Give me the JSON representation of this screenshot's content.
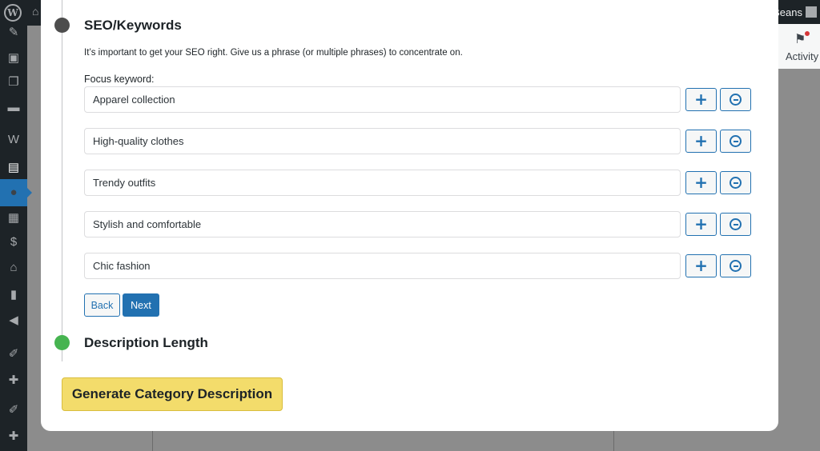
{
  "adminbar": {
    "wp_logo_glyph": "W",
    "home_glyph": "⌂",
    "user_name": "Beans"
  },
  "sidebar": {
    "items": [
      {
        "icon": "pin-icon",
        "glyph": "✎"
      },
      {
        "icon": "media-icon",
        "glyph": "▣"
      },
      {
        "icon": "pages-icon",
        "glyph": "❐"
      },
      {
        "icon": "comments-icon",
        "glyph": "▬"
      },
      {
        "icon": "woocommerce-icon",
        "glyph": "W"
      },
      {
        "icon": "products-icon",
        "glyph": "▤"
      },
      {
        "icon": "circle-icon",
        "glyph": "●"
      },
      {
        "icon": "layout-icon",
        "glyph": "▦"
      },
      {
        "icon": "payments-icon",
        "glyph": "$"
      },
      {
        "icon": "store-icon",
        "glyph": "⌂"
      },
      {
        "icon": "analytics-icon",
        "glyph": "▮"
      },
      {
        "icon": "marketing-icon",
        "glyph": "◀"
      },
      {
        "icon": "appearance-icon",
        "glyph": "✐"
      },
      {
        "icon": "plugins-icon",
        "glyph": "✚"
      },
      {
        "icon": "tools-icon",
        "glyph": "✐"
      },
      {
        "icon": "settings-icon",
        "glyph": "✚"
      }
    ]
  },
  "header": {
    "activity_label": "Activity",
    "flag_glyph": "⚑"
  },
  "seo": {
    "title": "SEO/Keywords",
    "intro": "It’s important to get your SEO right. Give us a phrase (or multiple phrases) to concentrate on.",
    "focus_label": "Focus keyword:",
    "plus_glyph": "+",
    "keywords": [
      "Apparel collection",
      "High-quality clothes",
      "Trendy outfits",
      "Stylish and comfortable",
      "Chic fashion"
    ],
    "back_label": "Back",
    "next_label": "Next"
  },
  "description": {
    "title": "Description Length"
  },
  "generate_label": "Generate Category Description",
  "colors": {
    "accent": "#2271b1",
    "active_step": "#46b450",
    "generate": "#f3dc6b",
    "admin_dark": "#1d2327"
  }
}
